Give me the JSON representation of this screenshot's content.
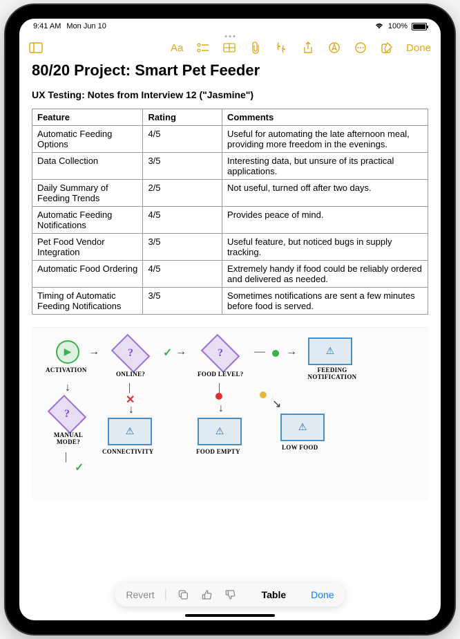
{
  "status": {
    "time": "9:41 AM",
    "date": "Mon Jun 10",
    "battery_pct": "100%"
  },
  "toolbar": {
    "done_label": "Done"
  },
  "note": {
    "title": "80/20 Project: Smart Pet Feeder",
    "subtitle": "UX Testing: Notes from Interview 12 (\"Jasmine\")"
  },
  "table": {
    "headers": [
      "Feature",
      "Rating",
      "Comments"
    ],
    "rows": [
      {
        "feature": "Automatic Feeding Options",
        "rating": "4/5",
        "comments": "Useful for automating the late afternoon meal, providing more freedom in the evenings."
      },
      {
        "feature": "Data Collection",
        "rating": "3/5",
        "comments": "Interesting data, but unsure of its practical applications."
      },
      {
        "feature": "Daily Summary of Feeding Trends",
        "rating": "2/5",
        "comments": "Not useful, turned off after two days."
      },
      {
        "feature": "Automatic Feeding Notifications",
        "rating": "4/5",
        "comments": "Provides peace of mind."
      },
      {
        "feature": "Pet Food Vendor Integration",
        "rating": "3/5",
        "comments": "Useful feature, but noticed bugs in supply tracking."
      },
      {
        "feature": "Automatic Food Ordering",
        "rating": "4/5",
        "comments": "Extremely handy if food could be reliably ordered and delivered as needed."
      },
      {
        "feature": "Timing of Automatic Feeding Notifications",
        "rating": "3/5",
        "comments": "Sometimes notifications are sent a few minutes before food is served."
      }
    ]
  },
  "sketch": {
    "labels": {
      "activation": "ACTIVATION",
      "online": "ONLINE?",
      "food_level": "FOOD LEVEL?",
      "feeding_notification": "FEEDING NOTIFICATION",
      "manual_mode": "MANUAL MODE?",
      "connectivity": "CONNECTIVITY",
      "food_empty": "FOOD EMPTY",
      "low_food": "LOW FOOD"
    }
  },
  "bottom_bar": {
    "revert_label": "Revert",
    "mode_label": "Table",
    "done_label": "Done"
  }
}
